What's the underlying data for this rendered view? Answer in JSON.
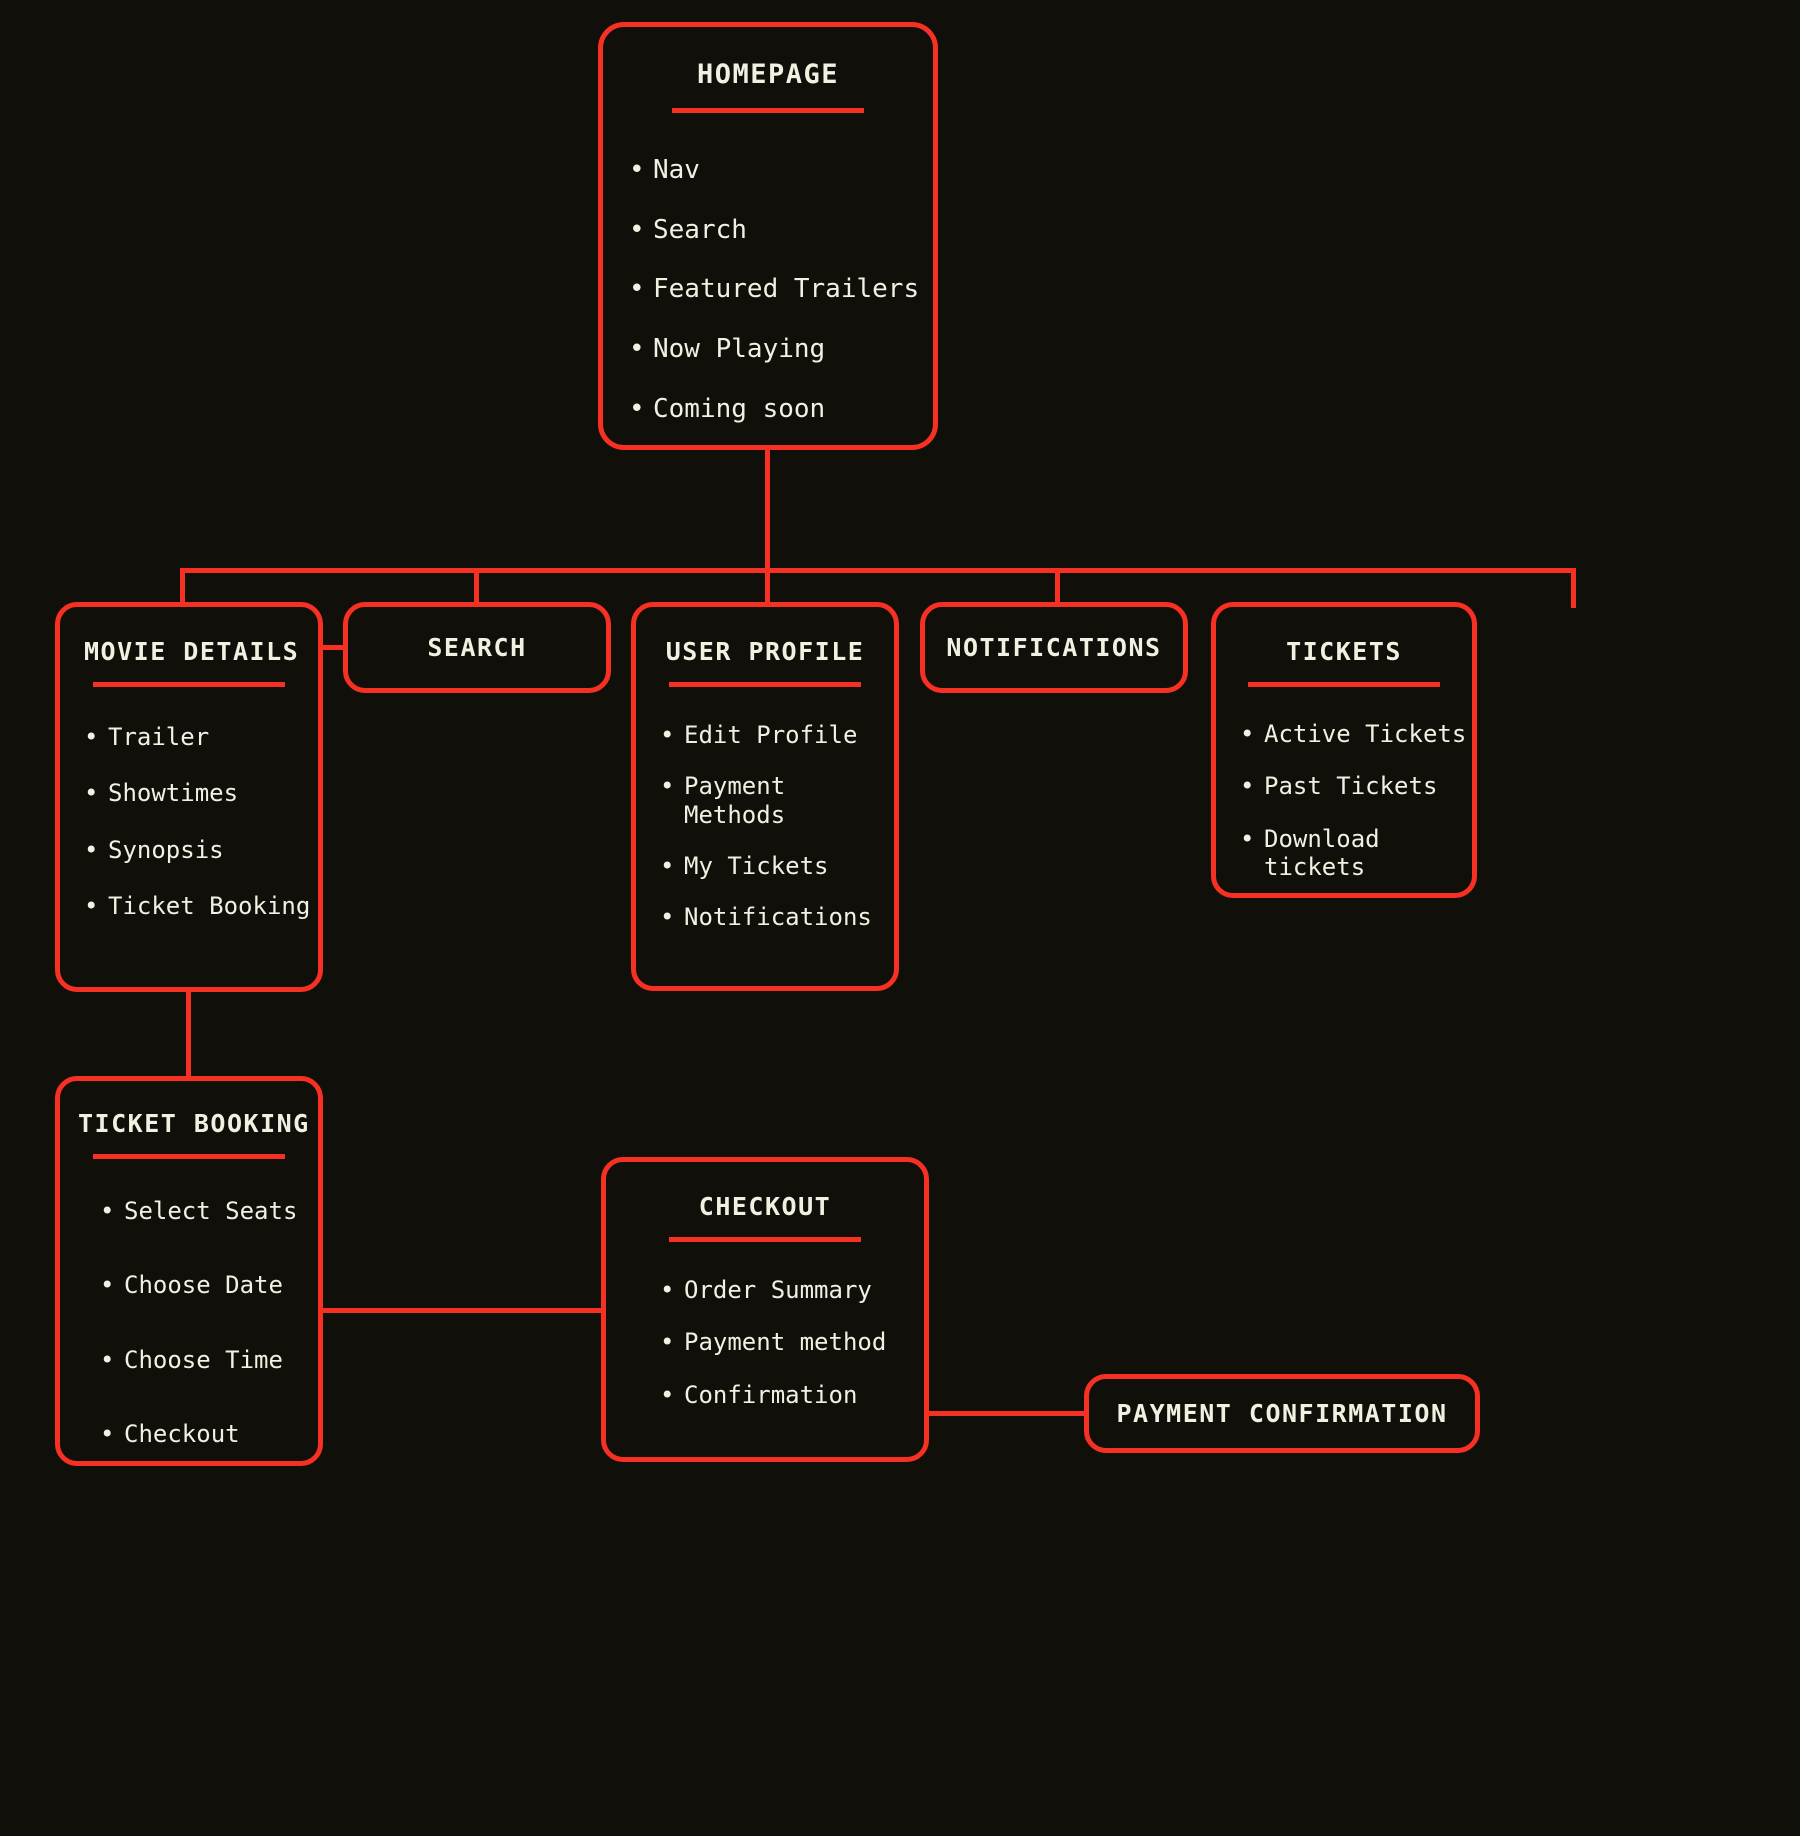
{
  "theme": {
    "background": "#100f0a",
    "accent": "#f63124",
    "text": "#f2f0e1"
  },
  "diagram": {
    "type": "sitemap-flowchart",
    "nodes": [
      {
        "id": "homepage",
        "title": "HOMEPAGE",
        "has_divider": true,
        "items": [
          "Nav",
          "Search",
          "Featured Trailers",
          "Now Playing",
          "Coming soon"
        ]
      },
      {
        "id": "movie-details",
        "title": "MOVIE DETAILS",
        "has_divider": true,
        "items": [
          "Trailer",
          "Showtimes",
          "Synopsis",
          "Ticket Booking"
        ]
      },
      {
        "id": "search",
        "title": "SEARCH",
        "has_divider": false,
        "items": []
      },
      {
        "id": "user-profile",
        "title": "USER PROFILE",
        "has_divider": true,
        "items": [
          "Edit Profile",
          "Payment Methods",
          "My Tickets",
          "Notifications"
        ]
      },
      {
        "id": "notifications",
        "title": "NOTIFICATIONS",
        "has_divider": false,
        "items": []
      },
      {
        "id": "tickets",
        "title": "TICKETS",
        "has_divider": true,
        "items": [
          "Active Tickets",
          "Past Tickets",
          "Download tickets"
        ]
      },
      {
        "id": "ticket-booking",
        "title": "TICKET BOOKING",
        "has_divider": true,
        "items": [
          "Select Seats",
          "Choose Date",
          "Choose Time",
          "Checkout"
        ]
      },
      {
        "id": "checkout",
        "title": "CHECKOUT",
        "has_divider": true,
        "items": [
          "Order Summary",
          "Payment method",
          "Confirmation"
        ]
      },
      {
        "id": "payment-confirmation",
        "title": "PAYMENT CONFIRMATION",
        "has_divider": false,
        "items": []
      }
    ],
    "edges": [
      {
        "from": "homepage",
        "to": "movie-details"
      },
      {
        "from": "homepage",
        "to": "search"
      },
      {
        "from": "homepage",
        "to": "user-profile"
      },
      {
        "from": "homepage",
        "to": "notifications"
      },
      {
        "from": "homepage",
        "to": "tickets"
      },
      {
        "from": "movie-details",
        "to": "search"
      },
      {
        "from": "movie-details",
        "to": "ticket-booking"
      },
      {
        "from": "ticket-booking",
        "to": "checkout"
      },
      {
        "from": "checkout",
        "to": "payment-confirmation"
      }
    ]
  }
}
